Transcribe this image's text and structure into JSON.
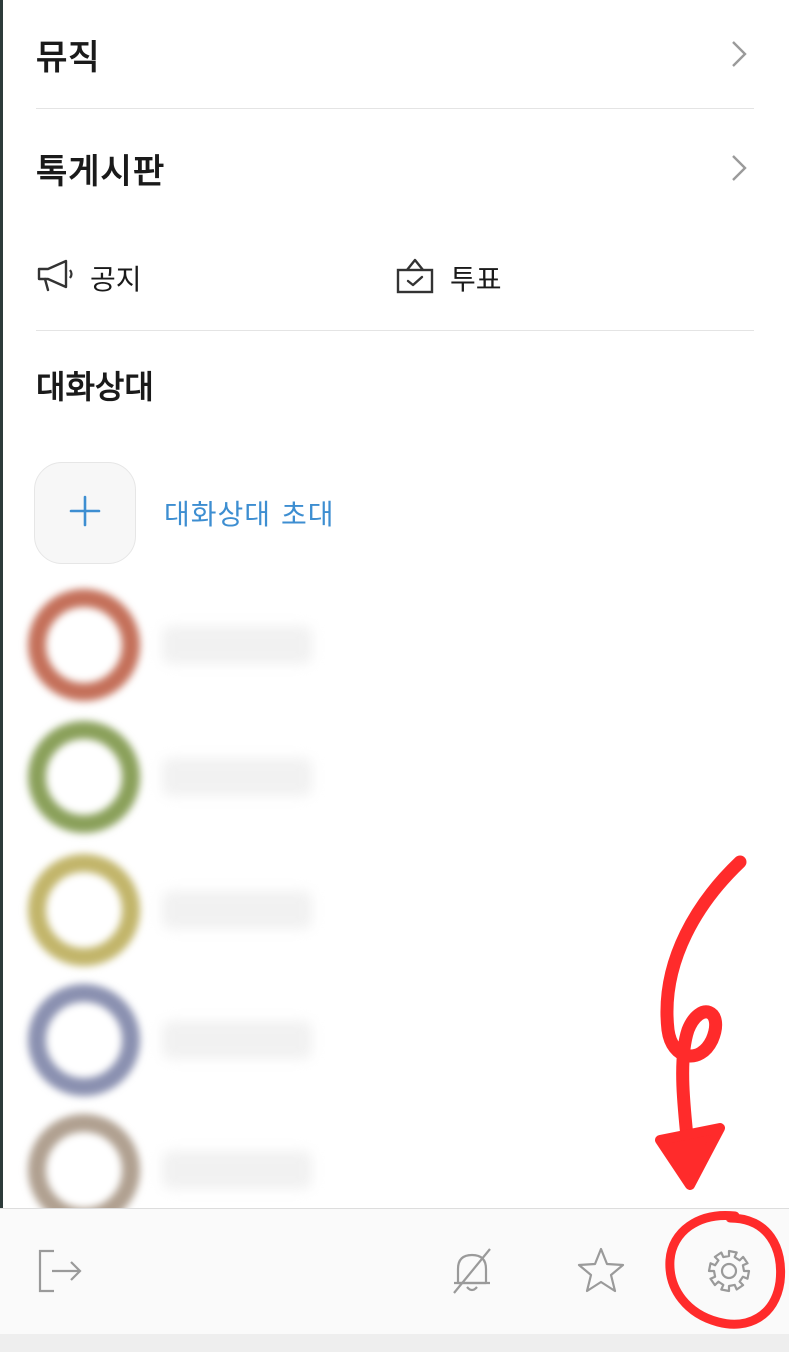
{
  "menu": {
    "music_label": "뮤직",
    "board_label": "톡게시판"
  },
  "quick_actions": {
    "notice_label": "공지",
    "vote_label": "투표"
  },
  "participants": {
    "section_title": "대화상대",
    "invite_label": "대화상대 초대"
  },
  "contacts": [
    {
      "ring_color": "#c4705a"
    },
    {
      "ring_color": "#8aa05a"
    },
    {
      "ring_color": "#c2b56a"
    },
    {
      "ring_color": "#8a90b0"
    },
    {
      "ring_color": "#b0a090"
    }
  ],
  "bottom_bar": {
    "icons": [
      "exit-icon",
      "bell-off-icon",
      "star-icon",
      "gear-icon"
    ]
  },
  "colors": {
    "accent": "#3d8ed1",
    "annotation": "#ff2b2b",
    "icon_gray": "#9a9a9a"
  }
}
